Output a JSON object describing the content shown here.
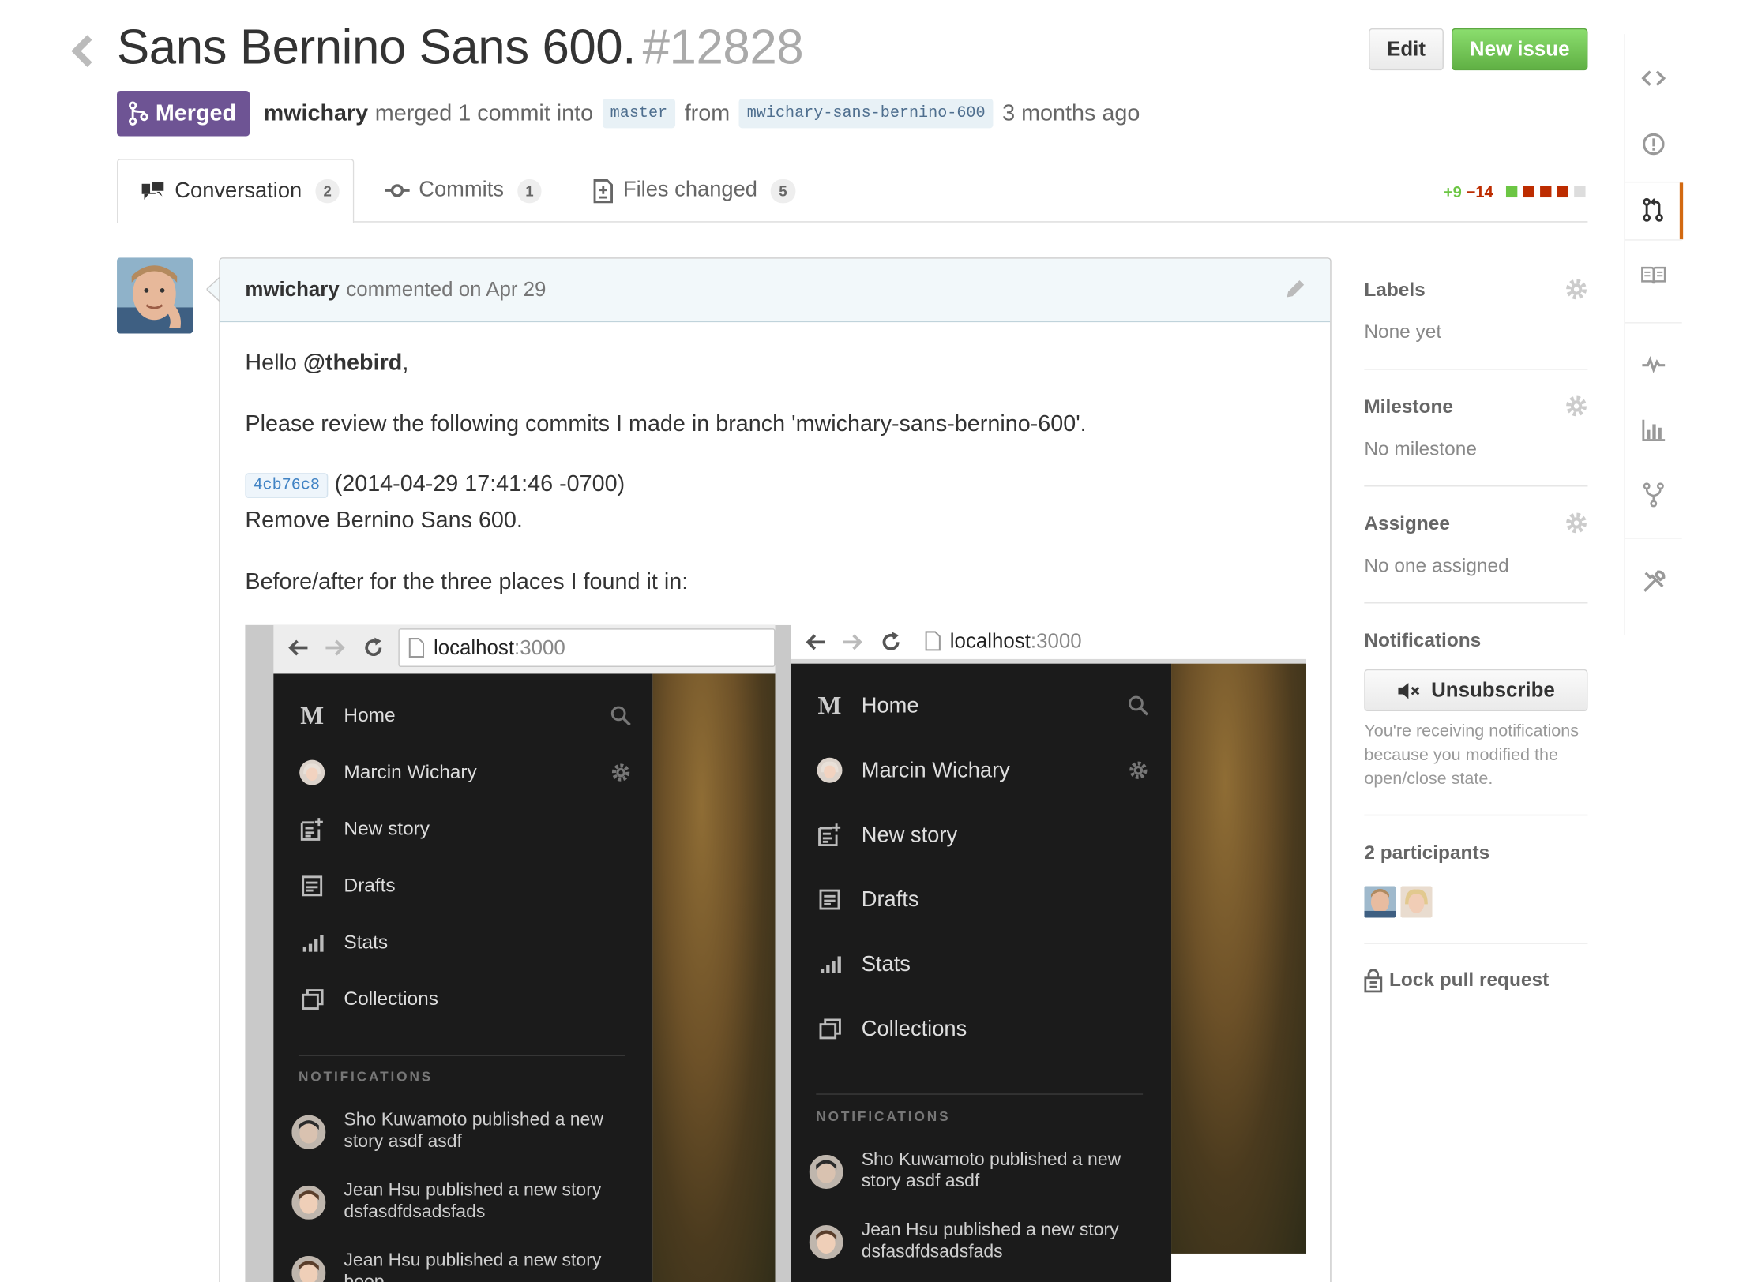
{
  "header": {
    "title": "Sans Bernino Sans 600.",
    "number": "#12828",
    "edit_label": "Edit",
    "new_issue_label": "New issue"
  },
  "meta": {
    "state": "Merged",
    "author": "mwichary",
    "action": "merged 1 commit into",
    "base_branch": "master",
    "from_label": "from",
    "head_branch": "mwichary-sans-bernino-600",
    "time": "3 months ago"
  },
  "tabs": [
    {
      "label": "Conversation",
      "count": "2"
    },
    {
      "label": "Commits",
      "count": "1"
    },
    {
      "label": "Files changed",
      "count": "5"
    }
  ],
  "diffstat": {
    "additions": "+9",
    "deletions": "−14"
  },
  "comment": {
    "author": "mwichary",
    "action": "commented on Apr 29",
    "greeting_prefix": "Hello ",
    "mention": "@thebird",
    "greeting_suffix": ",",
    "line1": "Please review the following commits I made in branch 'mwichary-sans-bernino-600'.",
    "sha": "4cb76c8",
    "commit_time": "(2014-04-29 17:41:46 -0700)",
    "commit_msg": "Remove Bernino Sans 600.",
    "line2": "Before/after for the three places I found it in:"
  },
  "screenshots": {
    "url_host": "localhost",
    "url_port": ":3000",
    "nav": [
      "Home",
      "Marcin Wichary",
      "New story",
      "Drafts",
      "Stats",
      "Collections"
    ],
    "notifications_heading": "NOTIFICATIONS",
    "notifications": [
      {
        "line1": "Sho Kuwamoto published a new",
        "line2": "story asdf asdf"
      },
      {
        "line1": "Jean Hsu published a new story",
        "line2": "dsfasdfdsadsfads"
      },
      {
        "line1": "Jean Hsu published a new story",
        "line2": "boop"
      }
    ]
  },
  "sidebar": {
    "labels_heading": "Labels",
    "labels_value": "None yet",
    "milestone_heading": "Milestone",
    "milestone_value": "No milestone",
    "assignee_heading": "Assignee",
    "assignee_value": "No one assigned",
    "notifications_heading": "Notifications",
    "unsubscribe_label": "Unsubscribe",
    "notifications_note": "You're receiving notifications because you modified the open/close state.",
    "participants_heading": "2 participants",
    "lock_label": "Lock pull request"
  },
  "colors": {
    "merged": "#6e5494",
    "new_issue": "#6cc644",
    "additions": "#6cc644",
    "deletions": "#bd2c00",
    "rail_selected": "#d26911"
  },
  "icons": {
    "rail": [
      "code-icon",
      "issue-icon",
      "pull-request-icon",
      "wiki-icon",
      "pulse-icon",
      "graphs-icon",
      "network-icon",
      "settings-icon"
    ]
  }
}
